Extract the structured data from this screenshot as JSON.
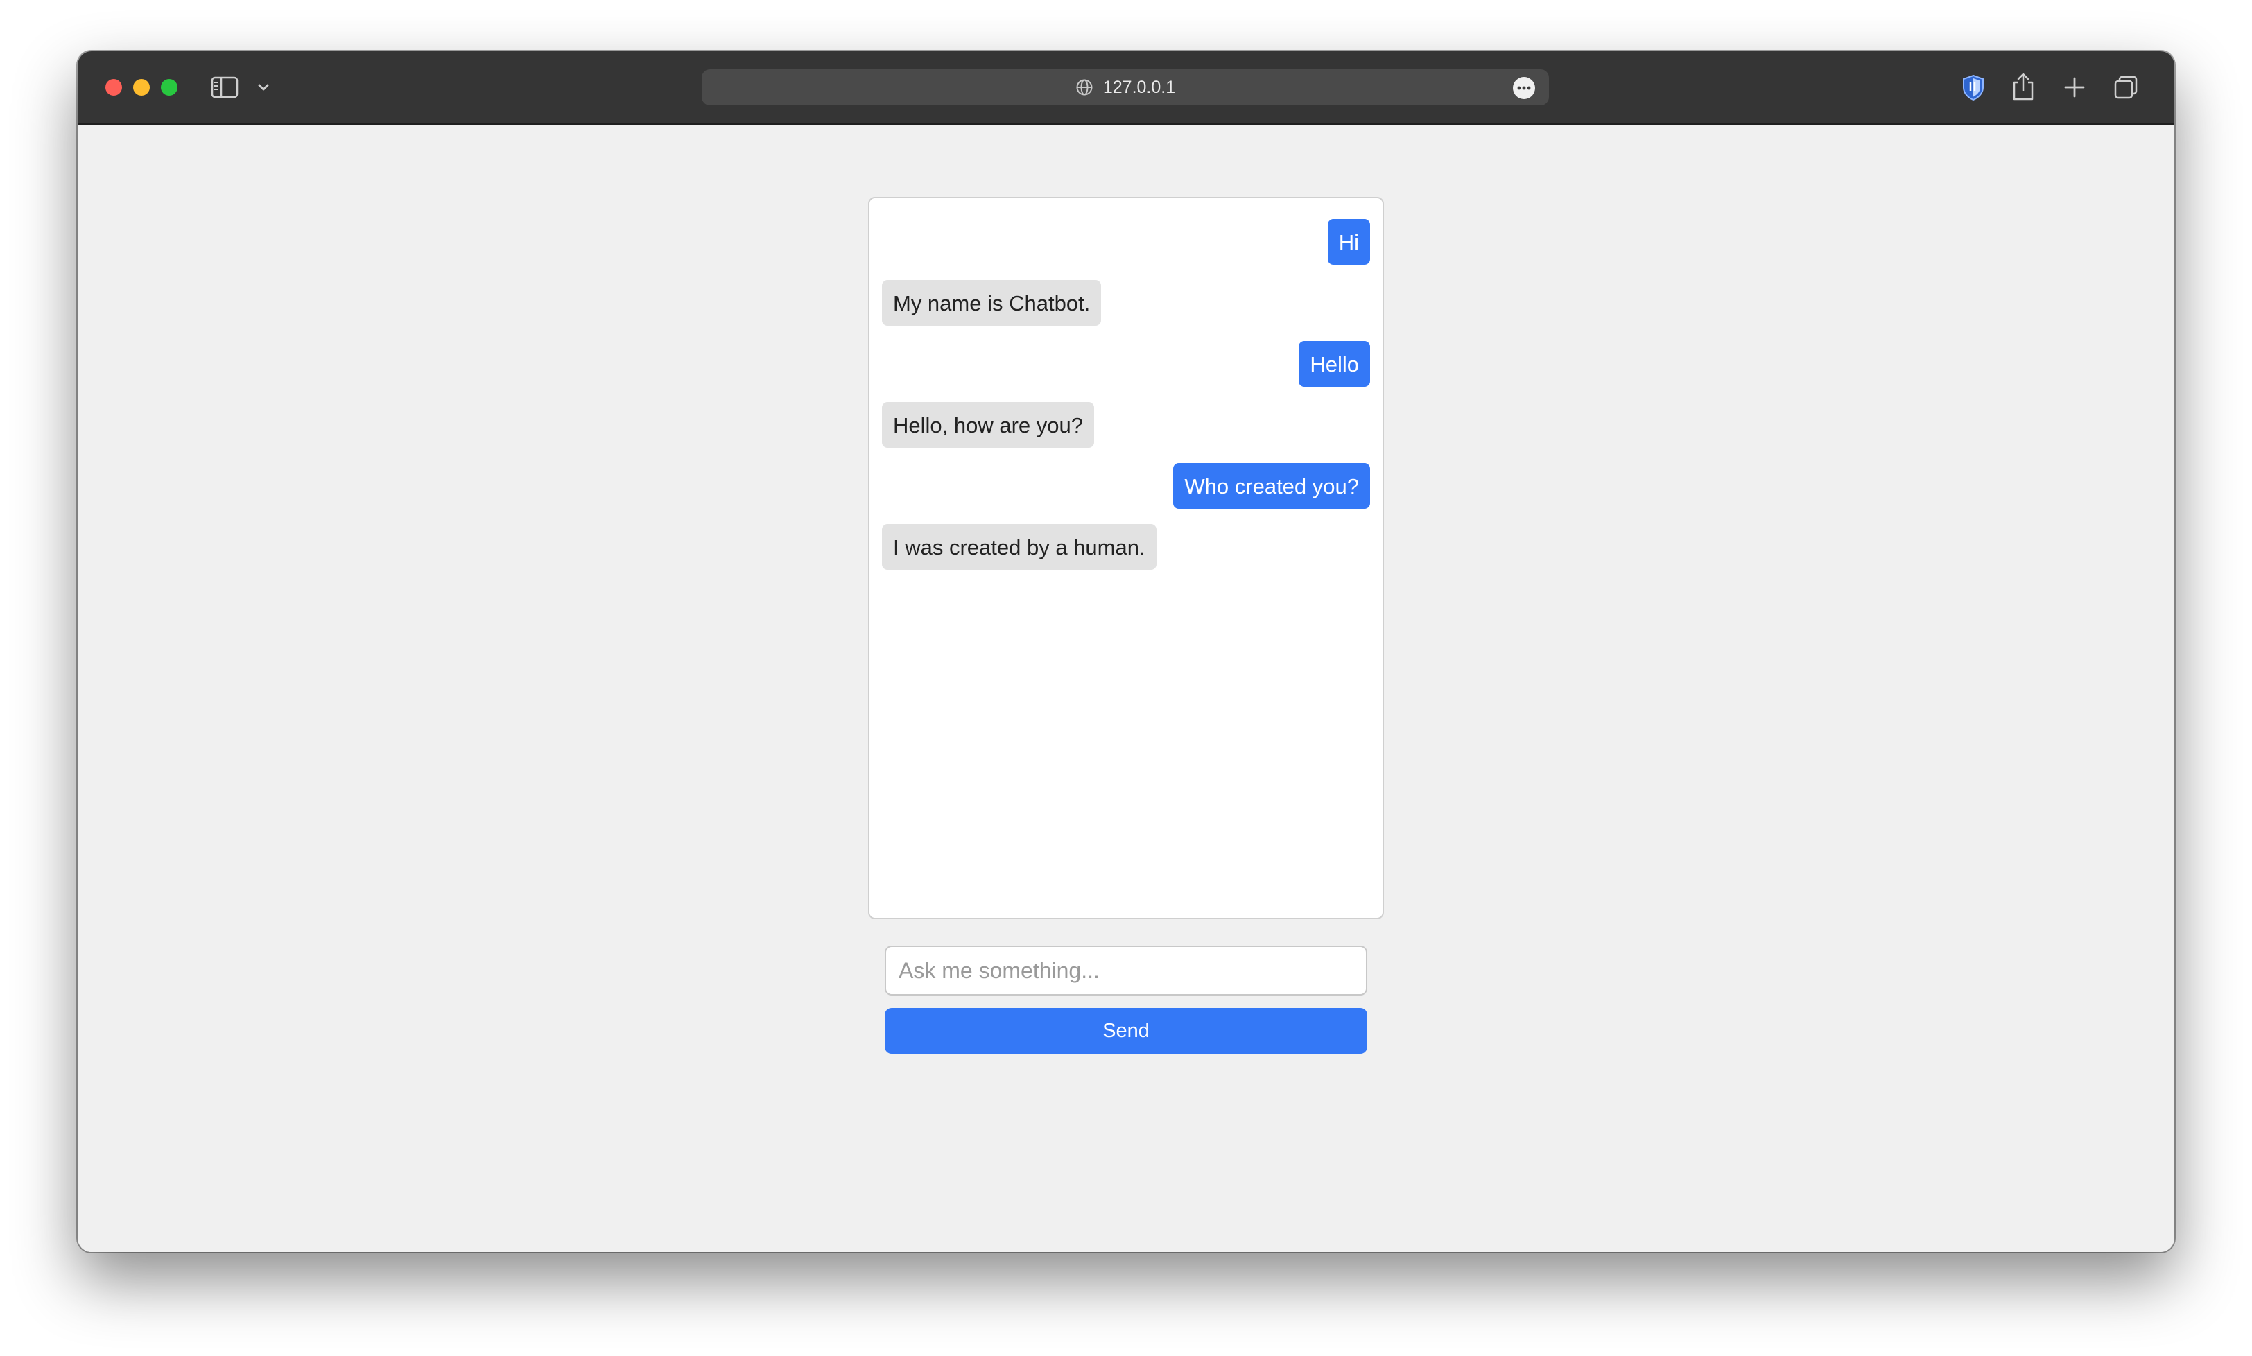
{
  "browser": {
    "url": "127.0.0.1",
    "icons": {
      "sidebar": "sidebar-icon",
      "chevron": "chevron-down-icon",
      "site": "globe-icon",
      "page_menu": "more-icon",
      "extension": "shield-icon",
      "share": "share-icon",
      "new_tab": "plus-icon",
      "tabs_overview": "tabs-icon"
    }
  },
  "chat": {
    "messages": [
      {
        "sender": "user",
        "text": "Hi"
      },
      {
        "sender": "bot",
        "text": "My name is Chatbot."
      },
      {
        "sender": "user",
        "text": "Hello"
      },
      {
        "sender": "bot",
        "text": "Hello, how are you?"
      },
      {
        "sender": "user",
        "text": "Who created you?"
      },
      {
        "sender": "bot",
        "text": "I was created by a human."
      }
    ]
  },
  "input": {
    "placeholder": "Ask me something...",
    "value": ""
  },
  "send_button": {
    "label": "Send"
  },
  "colors": {
    "accent": "#3478f6",
    "bot_bubble": "#e2e2e2",
    "page_background": "#f0f0f0",
    "titlebar": "#353535"
  }
}
